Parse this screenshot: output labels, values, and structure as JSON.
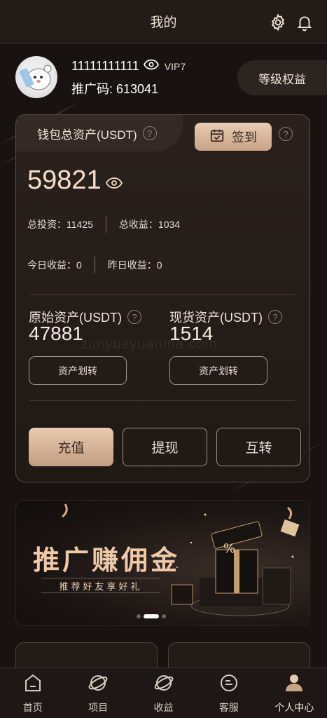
{
  "header": {
    "title": "我的"
  },
  "profile": {
    "user_id": "11111111111",
    "vip": "VIP7",
    "promo_code_text": "推广码: 613041",
    "level_button": "等级权益"
  },
  "wallet": {
    "tab_label": "钱包总资产(USDT)",
    "signin_label": "签到",
    "total": "59821",
    "total_invest": "总投资：11425",
    "total_income": "总收益：1034",
    "today_income": "今日收益：0",
    "yesterday_income": "昨日收益：0",
    "original_assets": {
      "title": "原始资产(USDT)",
      "value": "47881",
      "button": "资产划转"
    },
    "spot_assets": {
      "title": "现货资产(USDT)",
      "value": "1514",
      "button": "资产划转"
    },
    "actions": {
      "recharge": "充值",
      "withdraw": "提现",
      "transfer": "互转"
    }
  },
  "banner": {
    "title": "推广赚佣金",
    "subtitle": "推荐好友享好礼",
    "slides": 3,
    "active_slide": 1
  },
  "tabbar": {
    "items": [
      {
        "label": "首页",
        "icon": "home-icon"
      },
      {
        "label": "项目",
        "icon": "planet-icon"
      },
      {
        "label": "收益",
        "icon": "planet-icon"
      },
      {
        "label": "客服",
        "icon": "chat-icon"
      },
      {
        "label": "个人中心",
        "icon": "person-icon",
        "active": true
      }
    ]
  },
  "colors": {
    "accent": "#e8cab0",
    "background": "#181311"
  }
}
